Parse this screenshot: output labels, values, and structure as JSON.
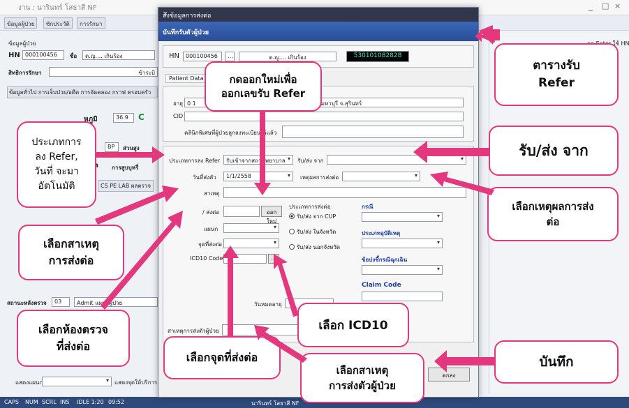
{
  "bg": {
    "title": "งาน : นารินทร์ โสธาสี NF",
    "tabs": [
      "ข้อมูลผู้ป่วย",
      "ซักประวัติ",
      "การรักษา"
    ],
    "patient_label": "ข้อมูลผู้ป่วย",
    "hn_label": "HN",
    "hn_value": "000100456",
    "name_label": "ชื่อ",
    "name_value": "ด.ญ.... เกินร้อง",
    "rights_label": "สิทธิการรักษา",
    "rights_value": "ข้าระบิ",
    "subtabs": "ข้อมูลทั่วไป  การเจ็บป่วย/อดีต  การจัดคลอง  กราฟ  ครอบครัว",
    "temp_label": "หภูมิ",
    "temp_value": "36.9",
    "temp_unit": "C",
    "bp_label": "BP",
    "height_label": "ส่วนสูง",
    "admin_label": "min",
    "smoke_label": "การสูบบุหรี่",
    "pe_tabs": "CS  PE  LAB  ผลตรวจ",
    "room_label": "สถานะหลังตรวจ",
    "room_value": "03",
    "admit_value": "Admit แผนกผู้ป่วย",
    "display_label": "แสดงแผนก",
    "display2_label": "แสดงจุดให้บริการ",
    "right_hint": "กด Enter ใช้ HN"
  },
  "status": {
    "caps": "CAPS",
    "num": "NUM",
    "scrl": "SCRL",
    "ins": "INS",
    "idle": "IDLE 1:20",
    "time": "09:52",
    "user": "นารินทร์ โสธาสี NF"
  },
  "dialog": {
    "title": "ลงข้อมูลการส่งต่อ",
    "close": "×",
    "header": "บันทึกรับตัวผู้ป่วย",
    "hn_label": "HN",
    "hn_value": "000100456",
    "name_value": "ด.ญ.... เกินร้อง",
    "refer_no": "530101082828",
    "tab_label": "Patient Data",
    "age_label": "อายุ",
    "age_value": "0 1",
    "address_value": "...ลงมหาบุรี จ.สุรินทร์",
    "cid_label": "CID",
    "note_label": "คลินิกพิเศษที่ผู้ป่วยลูกลงทะเบียนไว้แล้ว",
    "refer_type_label": "ประเภทการลง Refer",
    "refer_type_value": "รับเข้าจากสถานพยาบาลอื่น",
    "from_label": "รับ/ส่ง จาก",
    "date_label": "วันที่ส่งตัว",
    "date_value": "1/1/2558",
    "reason_label": "เหตุผลการส่งต่อ",
    "cause_label": "สาเหตุ",
    "refno_label": "/ ส่งต่อ",
    "new_btn": "ออกใหม่",
    "dept_label": "แผนก",
    "point_label": "จุดที่ส่งต่อ",
    "icd_label": "ICD10 Code",
    "icd_btn": "...",
    "patient_cause_label": "สาเหตุการส่งตัวผู้ป่วย",
    "doctor_label": "วันหมดอายุ",
    "send_type_label": "ประเภทการส่งต่อ",
    "radio1": "รับ/ส่ง จาก CUP",
    "radio2": "รับ/ส่ง ในจังหวัด",
    "radio3": "รับ/ส่ง นอกจังหวัด",
    "r_label1": "กรณี",
    "r_label2": "ประเภทอุบัติเหตุ",
    "r_label3": "ข้อบ่งชี้กรณีฉุกเฉิน",
    "claim_label": "Claim Code",
    "ok_btn": "ตกลง"
  },
  "callouts": {
    "c1": "กดออกใหม่เพื่อ\nออกเลขรับ Refer",
    "c2": "ตารางรับ\nRefer",
    "c3": "ประเภทการ\nลง Refer,\nวันที่ จะมา\nอัตโนมัติ",
    "c4": "รับ/ส่ง จาก",
    "c5": "เลือกเหตุผลการส่ง\nต่อ",
    "c6": "เลือกสาเหตุ\nการส่งต่อ",
    "c7": "เลือกห้องตรวจ\nที่ส่งต่อ",
    "c8": "เลือก ICD10",
    "c9": "บันทึก",
    "c10": "เลือกจุดที่ส่งต่อ",
    "c11": "เลือกสาเหตุ\nการส่งตัวผู้ป่วย"
  },
  "colors": {
    "accent": "#e3377e",
    "dialog_head": "#2a4e96",
    "title_bar": "#31364a"
  }
}
